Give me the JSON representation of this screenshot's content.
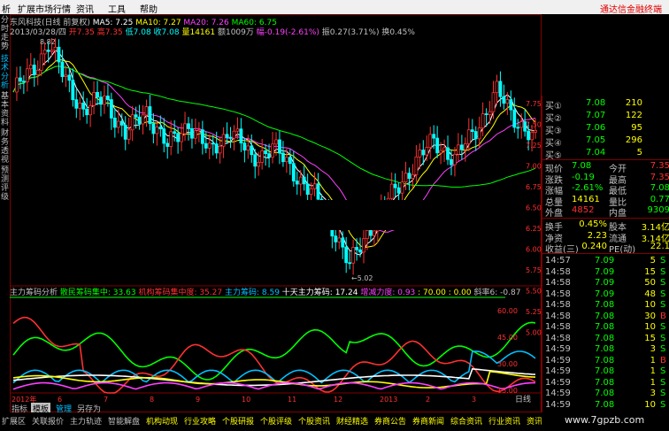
{
  "menu": {
    "items": [
      "析",
      "扩展市场行情",
      "资讯",
      "工具",
      "帮助"
    ]
  },
  "brand": {
    "text": "通达信金融终端"
  },
  "left_tabs": [
    {
      "text": "分时走势",
      "active": false
    },
    {
      "text": "技术分析",
      "active": true
    },
    {
      "text": "基本资料",
      "active": false
    },
    {
      "text": "财务透视",
      "active": false
    },
    {
      "text": "预测评级",
      "active": false
    }
  ],
  "info": {
    "title": "东风科技(日线 前复权)",
    "ma5": "MA5: 7.25",
    "ma10": "MA10: 7.27",
    "ma20": "MA20: 7.26",
    "ma60": "MA60: 6.75",
    "date": "2013/03/28/四",
    "open": "开7.35",
    "high": "高7.35",
    "low": "低7.08",
    "close": "收7.08",
    "volume": "量14161",
    "amount": "额1009万",
    "change": "幅-0.19(-2.61%)",
    "amplitude": "振0.27(3.71%)",
    "turnover": "换0.45%"
  },
  "price_axis": [
    "7.75",
    "7.50",
    "7.25",
    "7.00",
    "6.75",
    "6.50",
    "6.25",
    "6.00",
    "5.75",
    "5.50",
    "5.25",
    "5.00"
  ],
  "annotations": {
    "high_mark": "8.82",
    "low_mark": "5.02"
  },
  "indicator": {
    "name": "主力筹码分析",
    "items": [
      {
        "label": "散民筹码集中: 33.63",
        "color": "#00ff00"
      },
      {
        "label": "机构筹码集中度: 35.27",
        "color": "#ff3030"
      },
      {
        "label": "主力筹码: 8.59",
        "color": "#00c0ff"
      },
      {
        "label": "十天主力筹码: 17.24",
        "color": "#ffffff"
      },
      {
        "label": "增减力度: 0.93",
        "color": "#ff40ff"
      },
      {
        "label": ": 70.00",
        "color": "#ffff00"
      },
      {
        "label": ": 0.00",
        "color": "#ffff00"
      },
      {
        "label": "斜率6: -0.87",
        "color": "#c0c0c0"
      }
    ],
    "axis": [
      "60.00",
      "45.00",
      "30.00",
      "15.00"
    ]
  },
  "time_axis": [
    "2012年",
    "6",
    "7",
    "8",
    "9",
    "10",
    "11",
    "12",
    "2013",
    "2",
    "3"
  ],
  "quote": {
    "bids": [
      {
        "label": "买①",
        "price": "7.08",
        "vol": "210"
      },
      {
        "label": "买②",
        "price": "7.07",
        "vol": "122"
      },
      {
        "label": "买③",
        "price": "7.06",
        "vol": "95"
      },
      {
        "label": "买④",
        "price": "7.05",
        "vol": "296"
      },
      {
        "label": "买⑤",
        "price": "7.04",
        "vol": "5"
      }
    ],
    "stats": [
      {
        "l1": "现价",
        "v1": "7.08",
        "l2": "今开",
        "v2": "7.35",
        "c1": "#00ff00",
        "c2": "#ff3030"
      },
      {
        "l1": "涨跌",
        "v1": "-0.19",
        "l2": "最高",
        "v2": "7.35",
        "c1": "#00ff00",
        "c2": "#ff3030"
      },
      {
        "l1": "涨幅",
        "v1": "-2.61%",
        "l2": "最低",
        "v2": "7.08",
        "c1": "#00ff00",
        "c2": "#00ff00"
      },
      {
        "l1": "总量",
        "v1": "14161",
        "l2": "量比",
        "v2": "0.77",
        "c1": "#ffff00",
        "c2": "#00ff00"
      },
      {
        "l1": "外盘",
        "v1": "4852",
        "l2": "内盘",
        "v2": "9309",
        "c1": "#ff3030",
        "c2": "#00ff00"
      }
    ],
    "fundamentals": [
      {
        "l1": "换手",
        "v1": "0.45%",
        "l2": "股本",
        "v2": "3.14亿"
      },
      {
        "l1": "净资",
        "v1": "2.23",
        "l2": "流通",
        "v2": "3.14亿"
      },
      {
        "l1": "收益(三)",
        "v1": "0.240",
        "l2": "PE(动)",
        "v2": "22.1"
      }
    ],
    "ticks": [
      {
        "time": "14:57",
        "price": "7.09",
        "vol": "5",
        "side": "S"
      },
      {
        "time": "14:58",
        "price": "7.09",
        "vol": "15",
        "side": "S"
      },
      {
        "time": "14:58",
        "price": "7.09",
        "vol": "50",
        "side": "S"
      },
      {
        "time": "14:58",
        "price": "7.09",
        "vol": "48",
        "side": "S"
      },
      {
        "time": "14:58",
        "price": "7.08",
        "vol": "10",
        "side": "S"
      },
      {
        "time": "14:58",
        "price": "7.08",
        "vol": "30",
        "side": "B"
      },
      {
        "time": "14:58",
        "price": "7.08",
        "vol": "10",
        "side": "S"
      },
      {
        "time": "14:58",
        "price": "7.08",
        "vol": "15",
        "side": "S"
      },
      {
        "time": "14:59",
        "price": "7.08",
        "vol": "3",
        "side": "S"
      },
      {
        "time": "14:59",
        "price": "7.08",
        "vol": "1",
        "side": "B"
      },
      {
        "time": "14:59",
        "price": "7.08",
        "vol": "1",
        "side": "S"
      },
      {
        "time": "14:59",
        "price": "7.08",
        "vol": "1",
        "side": "S"
      },
      {
        "time": "14:59",
        "price": "7.08",
        "vol": "3",
        "side": "S"
      },
      {
        "time": "14:59",
        "price": "7.08",
        "vol": "10",
        "side": "S"
      }
    ]
  },
  "bottom_tabs": [
    {
      "text": "指标",
      "active": false
    },
    {
      "text": "模板",
      "active": true
    },
    {
      "text": "管理",
      "active": false,
      "color": "#00c0ff"
    },
    {
      "text": "另存为",
      "active": false
    }
  ],
  "period_label": "日线",
  "status_items": [
    "扩展区",
    "关联报价",
    "主力轨迹",
    "智能解盘",
    "机构动现",
    "行业攻略",
    "个股研报",
    "个股评级",
    "个股资讯",
    "财经精选",
    "券商公告",
    "券商新闻",
    "综合资讯",
    "行业资讯",
    "资讯工场"
  ],
  "watermark": "www.7gpzb.com",
  "colors": {
    "up": "#ff3030",
    "down": "#00ffff",
    "ma5": "#ffffff",
    "ma10": "#ffff00",
    "ma20": "#ff40ff",
    "ma60": "#00ff00",
    "frame": "#800000"
  }
}
